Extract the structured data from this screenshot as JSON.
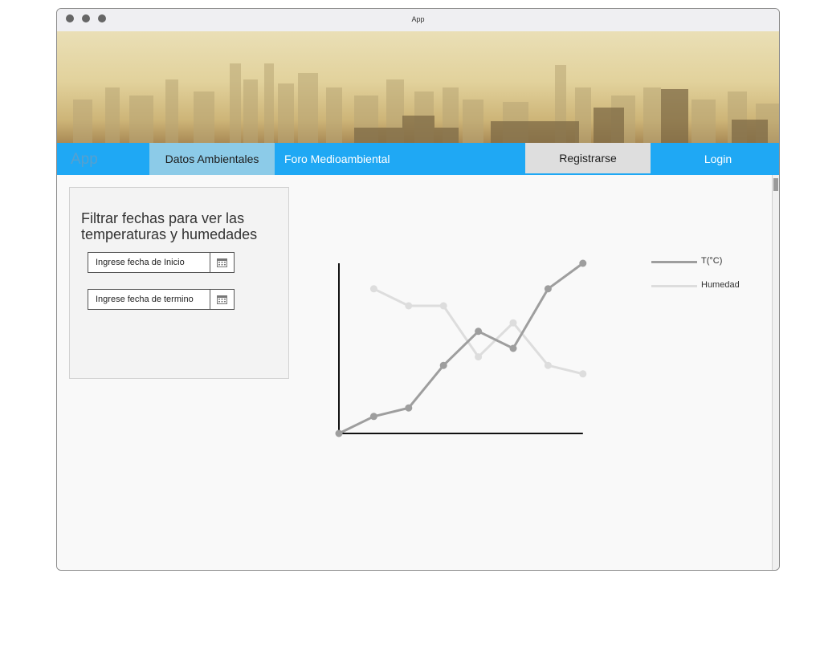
{
  "window": {
    "title": "App"
  },
  "navbar": {
    "brand": "App",
    "items": [
      "Datos Ambientales",
      "Foro Medioambiental"
    ],
    "register": "Registrarse",
    "login": "Login"
  },
  "filter": {
    "title": "Filtrar fechas para ver las temperaturas y humedades",
    "start_placeholder": "Ingrese fecha de Inicio",
    "end_placeholder": "Ingrese fecha de termino"
  },
  "colors": {
    "accent": "#1fa8f4",
    "active_tab": "#8ccbe8",
    "temp_series": "#9e9e9e",
    "humidity_series": "#dddddd"
  },
  "chart_data": {
    "type": "line",
    "x": [
      0,
      1,
      2,
      3,
      4,
      5,
      6,
      7
    ],
    "series": [
      {
        "name": "T(°C)",
        "color": "#9e9e9e",
        "values": [
          0,
          2,
          3,
          8,
          12,
          10,
          17,
          20
        ]
      },
      {
        "name": "Humedad",
        "color": "#dddddd",
        "values": [
          null,
          17,
          15,
          15,
          9,
          13,
          8,
          7
        ]
      }
    ],
    "xlim": [
      0,
      7
    ],
    "ylim": [
      0,
      20
    ],
    "legend": "top-right",
    "grid": false
  }
}
